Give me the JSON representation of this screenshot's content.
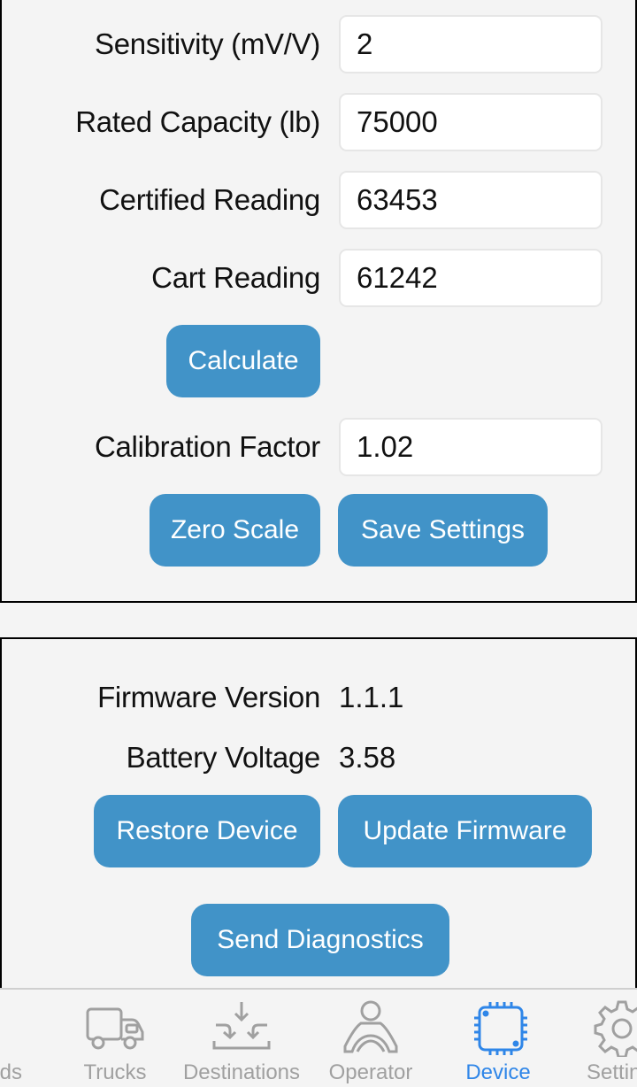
{
  "calibration": {
    "fields": [
      {
        "label": "Sensitivity (mV/V)",
        "value": "2"
      },
      {
        "label": "Rated Capacity (lb)",
        "value": "75000"
      },
      {
        "label": "Certified Reading",
        "value": "63453"
      },
      {
        "label": "Cart Reading",
        "value": "61242"
      }
    ],
    "calculate_label": "Calculate",
    "factor": {
      "label": "Calibration Factor",
      "value": "1.02"
    },
    "zero_scale_label": "Zero Scale",
    "save_settings_label": "Save Settings"
  },
  "device_info": {
    "firmware": {
      "label": "Firmware Version",
      "value": "1.1.1"
    },
    "battery": {
      "label": "Battery Voltage",
      "value": "3.58"
    },
    "restore_label": "Restore Device",
    "update_label": "Update Firmware",
    "diagnostics_label": "Send Diagnostics"
  },
  "nav": {
    "tabs": [
      {
        "label": "ds",
        "icon": "user-location-icon",
        "active": false
      },
      {
        "label": "Trucks",
        "icon": "truck-icon",
        "active": false
      },
      {
        "label": "Destinations",
        "icon": "destinations-icon",
        "active": false
      },
      {
        "label": "Operator",
        "icon": "operator-icon",
        "active": false
      },
      {
        "label": "Device",
        "icon": "chip-icon",
        "active": true
      },
      {
        "label": "Settin",
        "icon": "gear-icon",
        "active": false
      }
    ],
    "colors": {
      "active": "#2f86e8",
      "inactive": "#a0a0a0"
    }
  },
  "colors": {
    "button": "#4193c8",
    "background": "#f4f4f4"
  }
}
